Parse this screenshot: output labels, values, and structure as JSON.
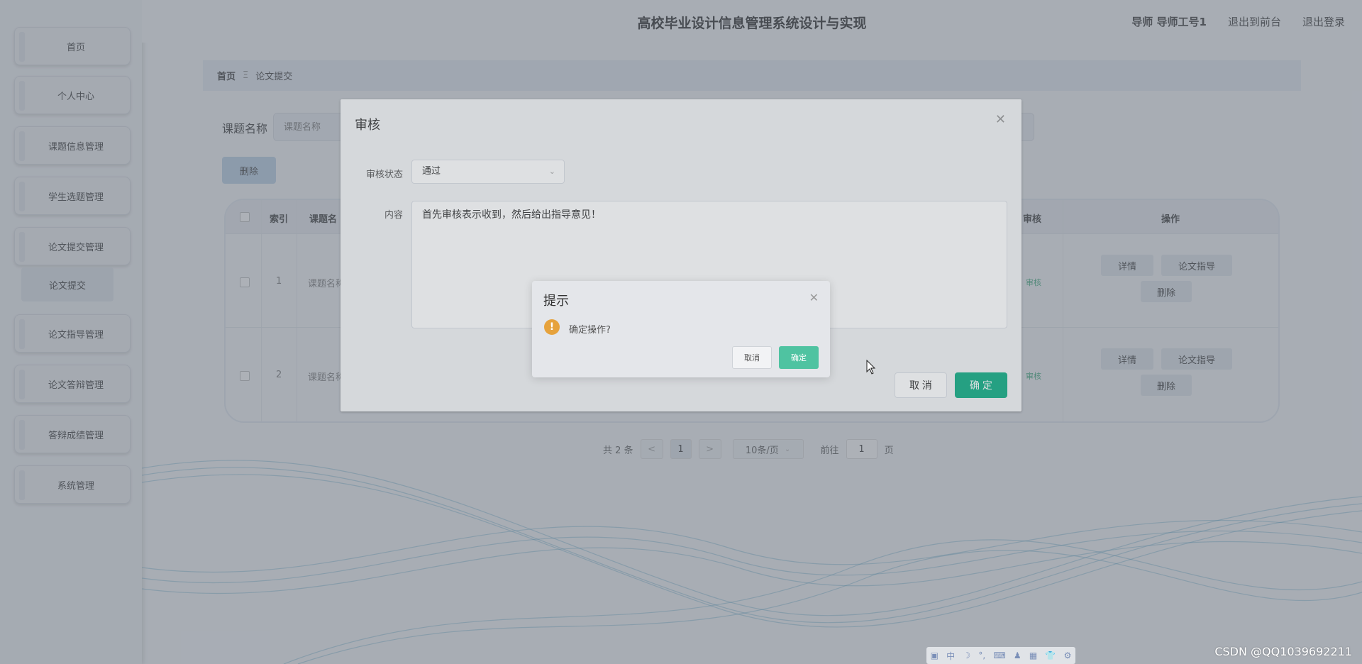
{
  "app": {
    "title": "高校毕业设计信息管理系统设计与实现",
    "user": "导师 导师工号1",
    "back_to_front": "退出到前台",
    "logout": "退出登录"
  },
  "sidebar": {
    "items": [
      {
        "label": "首页"
      },
      {
        "label": "个人中心"
      },
      {
        "label": "课题信息管理"
      },
      {
        "label": "学生选题管理"
      },
      {
        "label": "论文提交管理"
      },
      {
        "label": "论文指导管理"
      },
      {
        "label": "论文答辩管理"
      },
      {
        "label": "答辩成绩管理"
      },
      {
        "label": "系统管理"
      }
    ],
    "sub_item": "论文提交"
  },
  "breadcrumb": {
    "home": "首页",
    "separator": "Ξ",
    "current": "论文提交"
  },
  "search": {
    "label": "课题名称",
    "placeholder": "课题名称"
  },
  "toolbar": {
    "delete_label": "删除"
  },
  "table": {
    "headers": {
      "index": "索引",
      "topic": "课题名",
      "audit": "审核",
      "ops": "操作"
    },
    "rows": [
      {
        "index": "1",
        "topic": "课题名称",
        "status": "审核",
        "detail": "详情",
        "guide": "论文指导",
        "delete": "删除"
      },
      {
        "index": "2",
        "topic": "课题名称",
        "status": "审核",
        "detail": "详情",
        "guide": "论文指导",
        "delete": "删除"
      }
    ]
  },
  "pagination": {
    "total": "共 2 条",
    "prev": "<",
    "current": "1",
    "next": ">",
    "page_size": "10条/页",
    "goto_label": "前往",
    "goto_value": "1",
    "page_unit": "页"
  },
  "audit_dialog": {
    "title": "审核",
    "status_label": "审核状态",
    "status_value": "通过",
    "content_label": "内容",
    "content_value": "首先审核表示收到，然后给出指导意见！",
    "cancel": "取 消",
    "ok": "确 定"
  },
  "confirm_box": {
    "title": "提示",
    "message": "确定操作?",
    "cancel": "取消",
    "ok": "确定"
  },
  "watermark": "CSDN @QQ1039692211",
  "colors": {
    "primary": "#13ad85",
    "warning": "#e6a23c",
    "confirm_ok": "#4fc3a1"
  }
}
